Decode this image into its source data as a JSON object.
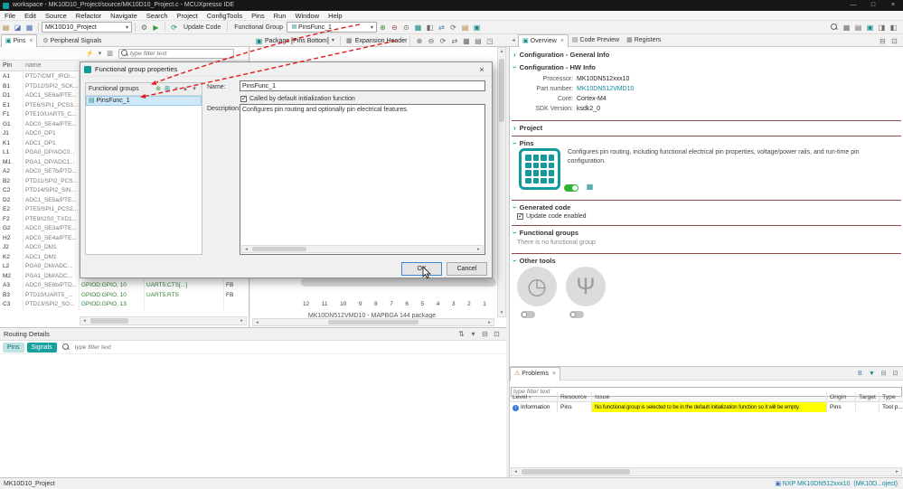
{
  "window": {
    "title": "workspace - MK10D10_Project/source/MK10D10_Project.c - MCUXpresso IDE",
    "controls": {
      "minimize": "—",
      "maximize": "□",
      "close": "×"
    }
  },
  "glyphs": {
    "chevron": "›",
    "dropdown": "▾",
    "close": "×",
    "back": "◂",
    "sb_left": "◂",
    "sb_right": "▸",
    "sb_up": "▴",
    "sb_down": "▾",
    "check": "✓",
    "warning": "⚠",
    "sort": "▾"
  },
  "menu": {
    "items": [
      "File",
      "Edit",
      "Source",
      "Refactor",
      "Navigate",
      "Search",
      "Project",
      "ConfigTools",
      "Pins",
      "Run",
      "Window",
      "Help"
    ]
  },
  "toolbar1": {
    "project": "MK10D10_Project",
    "update_code_label": "Update Code",
    "update_code_icon": "⟳",
    "functional_group_label": "Functional Group",
    "functional_group_value": "PinsFunc_1",
    "file_icons": [
      {
        "name": "new-button",
        "glyph": "▤",
        "c": "amber"
      },
      {
        "name": "save-button",
        "glyph": "◪",
        "c": "blue"
      },
      {
        "name": "save-all-button",
        "glyph": "▦",
        "c": "blue"
      }
    ],
    "edit_icons": [
      {
        "name": "build-button",
        "glyph": "⚙",
        "c": "gray"
      },
      {
        "name": "run-button",
        "glyph": "▶",
        "c": "green"
      }
    ],
    "pins_icons": [
      {
        "name": "add-pin-button",
        "glyph": "⊕",
        "c": "green"
      },
      {
        "name": "remove-pin-button",
        "glyph": "⊖",
        "c": "red"
      },
      {
        "name": "pin-conflicts-button",
        "glyph": "⊙",
        "c": "gray"
      },
      {
        "name": "pin-table-button",
        "glyph": "▦",
        "c": "teal"
      },
      {
        "name": "split-view-button",
        "glyph": "◧",
        "c": "gray"
      },
      {
        "name": "swap-pins-button",
        "glyph": "⇄",
        "c": "blue"
      },
      {
        "name": "refresh-button",
        "glyph": "⟳",
        "c": "gray"
      },
      {
        "name": "list-view-button",
        "glyph": "▤",
        "c": "amber"
      },
      {
        "name": "grid-view-button",
        "glyph": "▣",
        "c": "teal"
      }
    ],
    "right_icons": [
      {
        "name": "open-view-button",
        "glyph": "▦",
        "c": "gray"
      },
      {
        "name": "layout-button",
        "glyph": "▤",
        "c": "gray"
      },
      {
        "name": "perspective-pins-button",
        "glyph": "▣",
        "c": "teal"
      },
      {
        "name": "perspective-develop-button",
        "glyph": "◨",
        "c": "gray"
      },
      {
        "name": "perspective-extra-button",
        "glyph": "◧",
        "c": "gray"
      }
    ]
  },
  "toolbar2": {
    "pins_tab": "Pins",
    "peripheral_signals_tab": "Peripheral Signals",
    "package_label": "Package [Pins Bottom]",
    "expansion_label": "Expansion Header",
    "package_icons": [
      {
        "name": "zoom-in-button",
        "glyph": "⊕",
        "c": "gray"
      },
      {
        "name": "zoom-out-button",
        "glyph": "⊖",
        "c": "gray"
      },
      {
        "name": "rotate-package-button",
        "glyph": "⟳",
        "c": "gray"
      },
      {
        "name": "flip-package-button",
        "glyph": "⇄",
        "c": "gray"
      },
      {
        "name": "package-layers-button",
        "glyph": "▦",
        "c": "gray"
      },
      {
        "name": "package-labels-button",
        "glyph": "▤",
        "c": "gray"
      },
      {
        "name": "export-package-button",
        "glyph": "◳",
        "c": "gray"
      }
    ],
    "overview_tab": "Overview",
    "code_preview_tab": "Code Preview",
    "registers_tab": "Registers",
    "stack_controls": [
      {
        "name": "minimize-view-button",
        "glyph": "⊟",
        "c": "gray"
      },
      {
        "name": "maximize-view-button",
        "glyph": "⊡",
        "c": "gray"
      }
    ]
  },
  "pins_table": {
    "filter_placeholder": "type filter text",
    "filter_icons": [
      {
        "name": "flash-filter-toggle",
        "glyph": "⚡",
        "c": "amber"
      },
      {
        "name": "filter-dropdown",
        "glyph": "▾",
        "c": "gray"
      },
      {
        "name": "column-filter-toggle",
        "glyph": "▥",
        "c": "gray"
      }
    ],
    "col_pin": "Pin",
    "col_name": "name",
    "rows": [
      {
        "pin": "A1",
        "name": "PTD7/CMT_IRO/..."
      },
      {
        "pin": "B1",
        "name": "PTD12/SPI2_SCK..."
      },
      {
        "pin": "D1",
        "name": "ADC1_SE6a/PTE..."
      },
      {
        "pin": "E1",
        "name": "PTE6/SPI1_PCS3..."
      },
      {
        "pin": "F1",
        "name": "PTE10/UART5_C..."
      },
      {
        "pin": "G1",
        "name": "ADC0_SE4a/PTE..."
      },
      {
        "pin": "J1",
        "name": "ADC0_DP1"
      },
      {
        "pin": "K1",
        "name": "ADC1_DP1"
      },
      {
        "pin": "L1",
        "name": "PGA0_DP/ADC0..."
      },
      {
        "pin": "M1",
        "name": "PGA1_DP/ADC1..."
      },
      {
        "pin": "A2",
        "name": "ADC0_SE7b/PTD..."
      },
      {
        "pin": "B2",
        "name": "PTD11/SPI2_PCS..."
      },
      {
        "pin": "C2",
        "name": "PTD14/SPI2_SIN..."
      },
      {
        "pin": "D2",
        "name": "ADC1_SE5a/PTE..."
      },
      {
        "pin": "E2",
        "name": "PTE5/SPI1_PCS2..."
      },
      {
        "pin": "F2",
        "name": "PTE9/I2S0_TXD1..."
      },
      {
        "pin": "G2",
        "name": "ADC0_SE3a/PTE..."
      },
      {
        "pin": "H2",
        "name": "ADC0_SE4a/PTE..."
      },
      {
        "pin": "J2",
        "name": "ADC0_DM1"
      },
      {
        "pin": "K2",
        "name": "ADC1_DM1"
      },
      {
        "pin": "L2",
        "name": "PGA0_DM/ADC..."
      },
      {
        "pin": "M2",
        "name": "PGA1_DM/ADC..."
      },
      {
        "pin": "A3",
        "name": "ADC0_SE6b/PTD...",
        "f1": "GPIOD:GPIO, 10",
        "f2": "UART5:CTS[...]",
        "f3": "FB"
      },
      {
        "pin": "B3",
        "name": "PTD10/UART5_...",
        "f1": "GPIOD:GPIO, 10",
        "f2": "UART5:RTS",
        "f3": "FB"
      },
      {
        "pin": "C3",
        "name": "PTD13/SPI2_SO...",
        "f1": "GPIOD:GPIO, 13",
        "f2": "",
        "f3": ""
      }
    ]
  },
  "package_view": {
    "ruler": [
      "12",
      "11",
      "10",
      "9",
      "8",
      "7",
      "6",
      "5",
      "4",
      "3",
      "2",
      "1"
    ],
    "caption": "MK10DN512VMD10 - MAPBGA 144 package"
  },
  "dialog": {
    "title": "Functional group properties",
    "groups_panel_label": "Functional groups",
    "group_toolbar": [
      {
        "name": "add-group-button",
        "glyph": "⊕",
        "c": "green"
      },
      {
        "name": "clone-group-button",
        "glyph": "⊞",
        "c": "teal"
      },
      {
        "name": "delete-group-button",
        "glyph": "×",
        "c": "gray"
      },
      {
        "name": "move-up-button",
        "glyph": "▴",
        "c": "gray"
      },
      {
        "name": "move-down-button",
        "glyph": "▾",
        "c": "gray"
      }
    ],
    "group_item": "PinsFunc_1",
    "name_label": "Name:",
    "name_value": "PinsFunc_1",
    "default_init_label": "Called by default initialization function",
    "description_label": "Description:",
    "description_value": "Configures pin routing and optionally pin electrical features.",
    "ok_label": "OK",
    "cancel_label": "Cancel"
  },
  "overview": {
    "general_info_title": "Configuration - General Info",
    "hw_info": {
      "title": "Configuration - HW Info",
      "processor_label": "Processor:",
      "processor": "MK10DN512xxx10",
      "part_number_label": "Part number:",
      "part_number": "MK10DN512VMD10",
      "core_label": "Core:",
      "core": "Cortex-M4",
      "sdk_label": "SDK Version:",
      "sdk": "ksdk2_0"
    },
    "project_title": "Project",
    "pins_section": {
      "title": "Pins",
      "description": "Configures pin routing, including functional  electrical pin properties, voltage/power rails, and run-time pin configuration."
    },
    "generated_code": {
      "title": "Generated code",
      "update_code_label": "Update code enabled"
    },
    "functional_groups": {
      "title": "Functional groups",
      "empty_text": "There is no functional group"
    },
    "other_tools": {
      "title": "Other tools",
      "tools": [
        {
          "name": "clocks-tool-icon",
          "glyph": "◷"
        },
        {
          "name": "peripherals-tool-icon",
          "glyph": "Ψ"
        }
      ]
    }
  },
  "routing_details": {
    "title": "Routing Details",
    "pins_tab": "Pins",
    "signals_tab": "Signals",
    "filter_placeholder": "type filter text",
    "header_icons": [
      {
        "name": "link-editor-button",
        "glyph": "⇅",
        "c": "gray"
      },
      {
        "name": "view-menu-button",
        "glyph": "▾",
        "c": "gray"
      },
      {
        "name": "minimize-view-button",
        "glyph": "⊟",
        "c": "gray"
      },
      {
        "name": "maximize-view-button",
        "glyph": "⊡",
        "c": "gray"
      }
    ]
  },
  "problems": {
    "tab": "Problems",
    "filter_placeholder": "type filter text",
    "header_icons": [
      {
        "name": "group-by-button",
        "glyph": "B",
        "c": "blue"
      },
      {
        "name": "filter-problems-button",
        "glyph": "▼",
        "c": "teal"
      },
      {
        "name": "minimize-view-button",
        "glyph": "⊟",
        "c": "gray"
      },
      {
        "name": "maximize-view-button",
        "glyph": "⊡",
        "c": "gray"
      }
    ],
    "columns": [
      "Level",
      "Resource",
      "Issue",
      "Origin",
      "Target",
      "Type"
    ],
    "rows": [
      {
        "level": "Information",
        "resource": "Pins",
        "issue": "No functional group is selected to be in the default initialization function so it will be empty.",
        "origin": "Pins",
        "target": "",
        "type": "Tool p..."
      }
    ]
  },
  "status_bar": {
    "left": "MK10D10_Project",
    "device_link": "NXP MK10DN512xxx10",
    "project_link": "(MK10D...oject)"
  },
  "colors": {
    "accent_teal": "#0f9b9b",
    "selection_blue": "#cde9f7",
    "warning_yellow": "#ffff00",
    "toggle_green": "#2eb52e",
    "annotation_red": "#e01b1b",
    "separator_maroon": "#8d4b4b"
  }
}
